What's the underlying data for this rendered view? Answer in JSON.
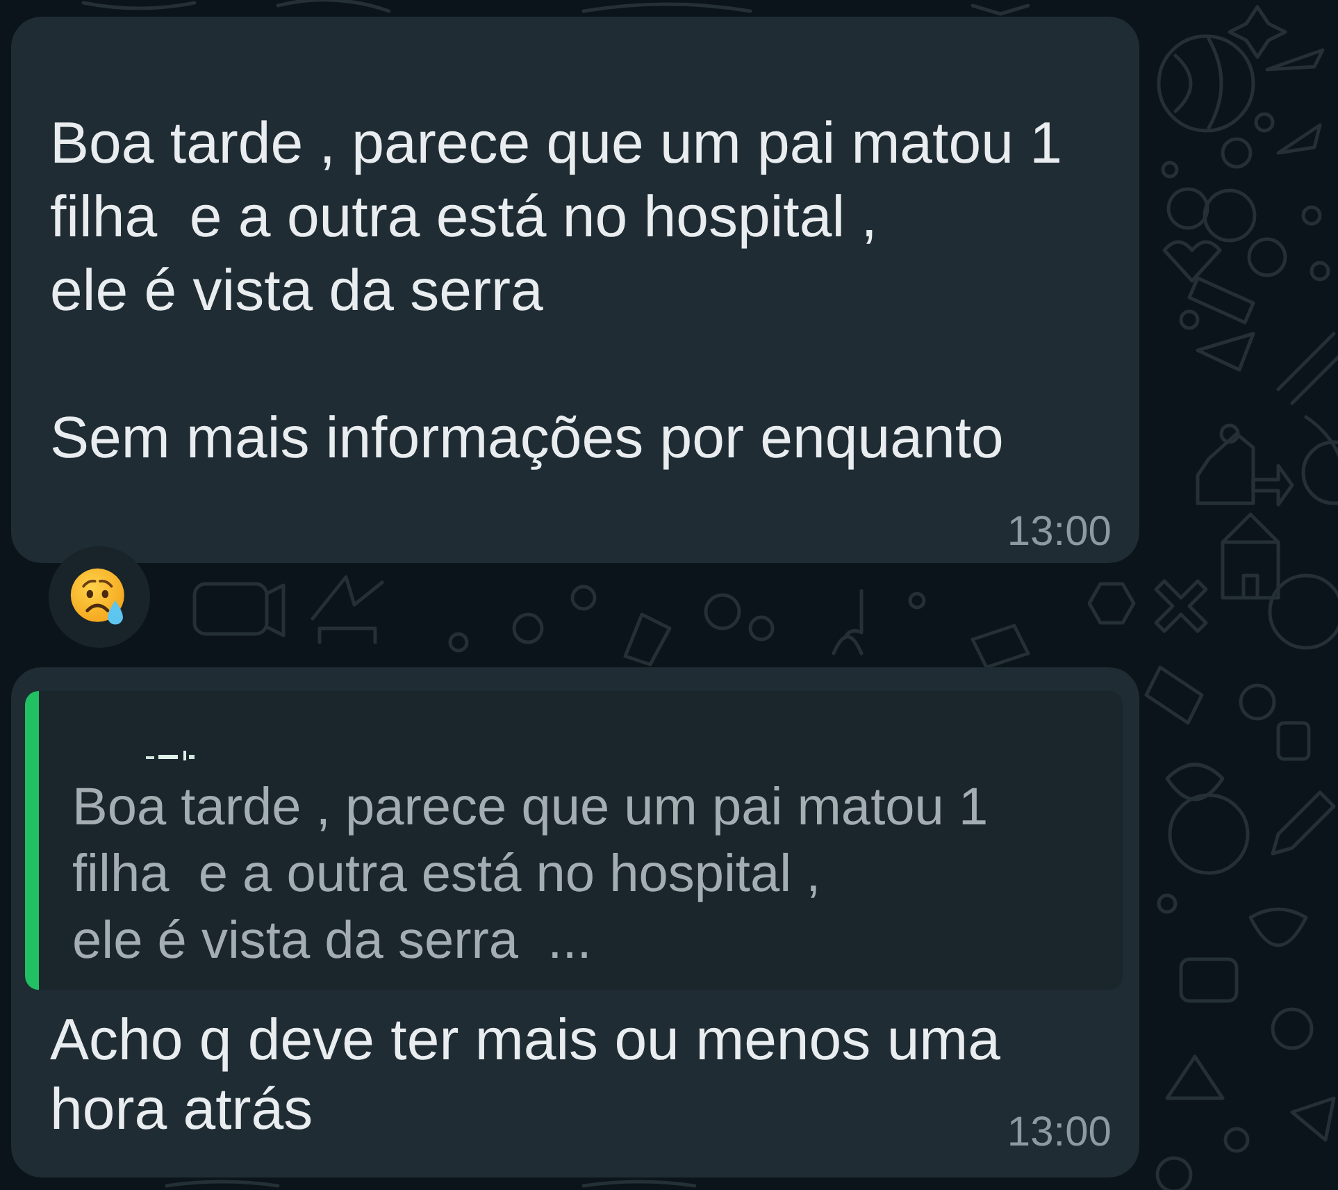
{
  "messages": [
    {
      "kind": "text",
      "text": "Boa tarde , parece que um pai matou 1\nfilha  e a outra está no hospital ,\nele é vista da serra\n\nSem mais informações por enquanto",
      "time": "13:00",
      "reaction": {
        "kind": "crying"
      }
    },
    {
      "kind": "reply",
      "quote": {
        "text": "Boa tarde , parece que um pai matou 1\nfilha  e a outra está no hospital ,\nele é vista da serra  ..."
      },
      "text": "Acho q deve ter mais ou menos uma\nhora atrás",
      "time": "13:00"
    }
  ]
}
